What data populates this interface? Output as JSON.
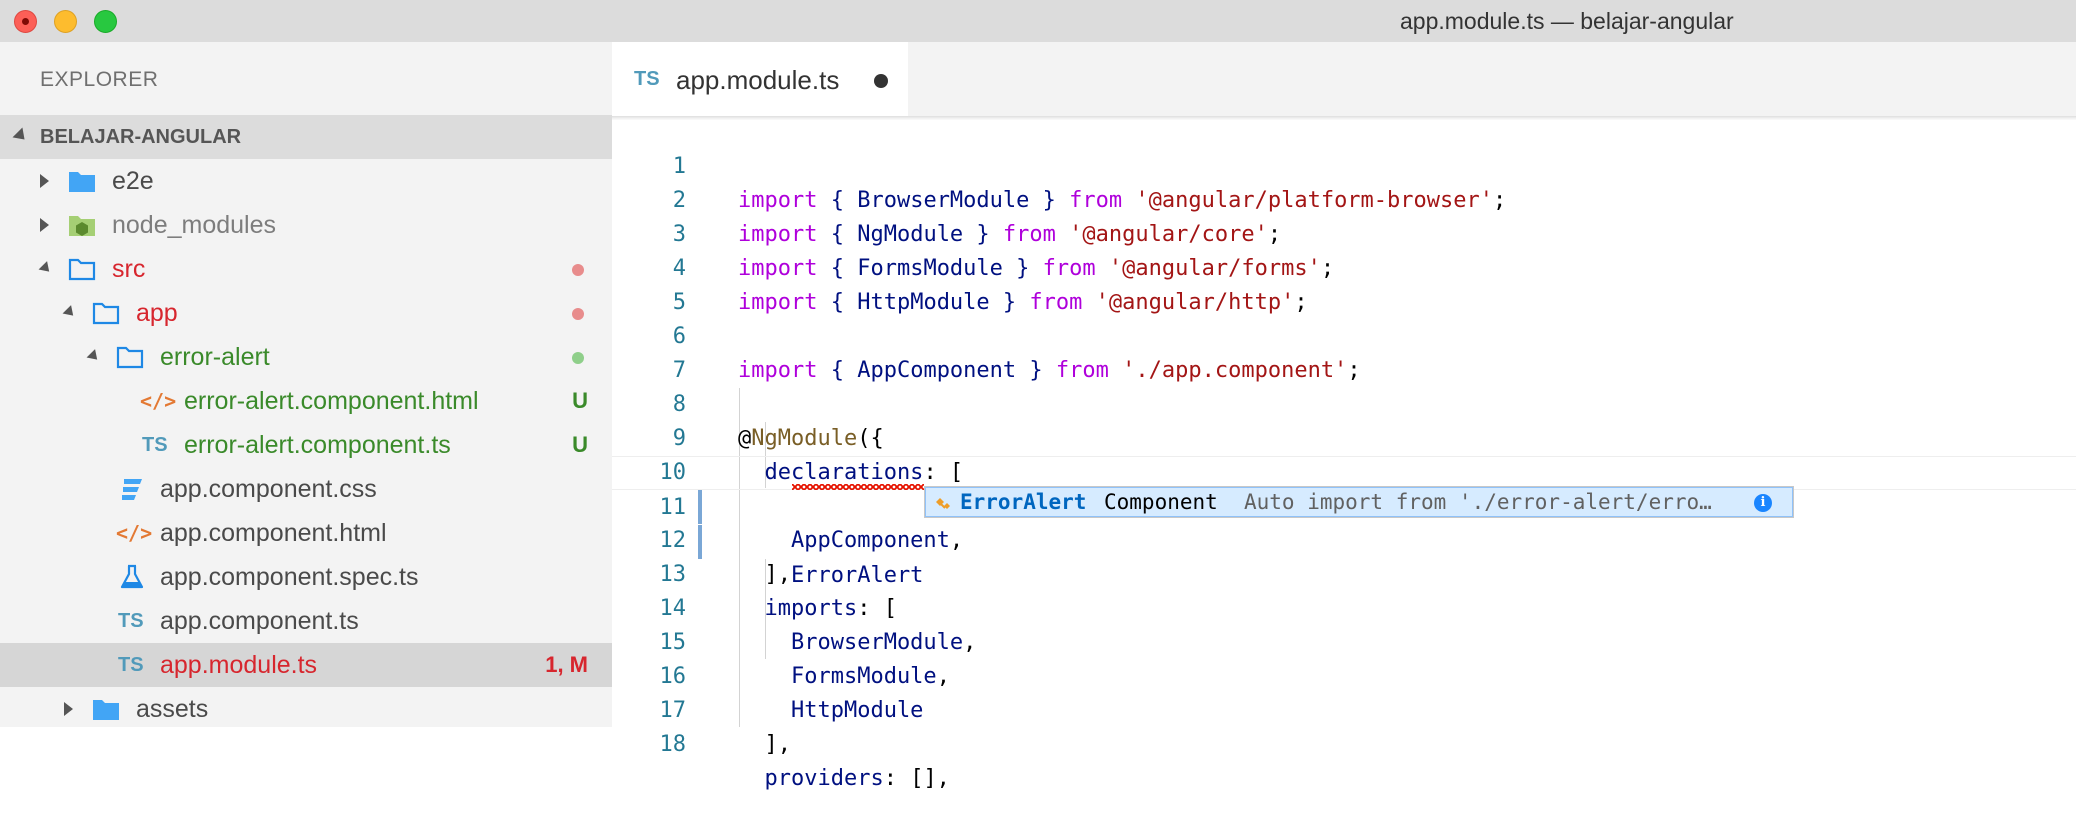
{
  "window": {
    "title": "app.module.ts — belajar-angular"
  },
  "sidebar": {
    "title": "EXPLORER",
    "section": "BELAJAR-ANGULAR",
    "items": [
      {
        "label": "e2e",
        "icon": "folder-icon",
        "status": ""
      },
      {
        "label": "node_modules",
        "icon": "node-folder-icon",
        "status": ""
      },
      {
        "label": "src",
        "icon": "folder-open-icon",
        "status": ""
      },
      {
        "label": "app",
        "icon": "folder-open-icon",
        "status": ""
      },
      {
        "label": "error-alert",
        "icon": "folder-open-icon",
        "status": ""
      },
      {
        "label": "error-alert.component.html",
        "icon": "html-file-icon",
        "status": "U"
      },
      {
        "label": "error-alert.component.ts",
        "icon": "ts-file-icon",
        "status": "U"
      },
      {
        "label": "app.component.css",
        "icon": "css-file-icon",
        "status": ""
      },
      {
        "label": "app.component.html",
        "icon": "html-file-icon",
        "status": ""
      },
      {
        "label": "app.component.spec.ts",
        "icon": "test-file-icon",
        "status": ""
      },
      {
        "label": "app.component.ts",
        "icon": "ts-file-icon",
        "status": ""
      },
      {
        "label": "app.module.ts",
        "icon": "ts-file-icon",
        "status": "1, M"
      },
      {
        "label": "assets",
        "icon": "folder-icon",
        "status": ""
      }
    ],
    "badges": {
      "ts": "TS",
      "html": "</>"
    }
  },
  "tab": {
    "badge": "TS",
    "label": "app.module.ts"
  },
  "code": {
    "line_numbers": [
      "1",
      "2",
      "3",
      "4",
      "5",
      "6",
      "7",
      "8",
      "9",
      "10",
      "11",
      "12",
      "13",
      "14",
      "15",
      "16",
      "17",
      "18"
    ],
    "l1": {
      "kw": "import",
      "a": " { BrowserModule } ",
      "from": "from",
      "s": " '@angular/platform-browser'",
      "e": ";"
    },
    "l2": {
      "kw": "import",
      "a": " { NgModule } ",
      "from": "from",
      "s": " '@angular/core'",
      "e": ";"
    },
    "l3": {
      "kw": "import",
      "a": " { FormsModule } ",
      "from": "from",
      "s": " '@angular/forms'",
      "e": ";"
    },
    "l4": {
      "kw": "import",
      "a": " { HttpModule } ",
      "from": "from",
      "s": " '@angular/http'",
      "e": ";"
    },
    "l6": {
      "kw": "import",
      "a": " { AppComponent } ",
      "from": "from",
      "s": " './app.component'",
      "e": ";"
    },
    "l8": {
      "at": "@",
      "deco": "NgModule",
      "rest": "({"
    },
    "l9": {
      "key": "  declarations",
      "rest": ": ["
    },
    "l10": {
      "id": "    AppComponent",
      "rest": ","
    },
    "l11": {
      "id": "    ErrorAlert"
    },
    "l12": {
      "rest": "  ],"
    },
    "l13": {
      "key": "  imports",
      "rest": ": ["
    },
    "l14": {
      "id": "    BrowserModule",
      "rest": ","
    },
    "l15": {
      "id": "    FormsModule",
      "rest": ","
    },
    "l16": {
      "id": "    HttpModule"
    },
    "l17": {
      "rest": "  ],"
    },
    "l18": {
      "key": "  providers",
      "rest": ": [],"
    }
  },
  "suggestion": {
    "match": "ErrorAlert",
    "rest": "Component",
    "detail": "Auto import from './error-alert/erro…",
    "info": "i"
  },
  "colors": {
    "keyword": "#af00db",
    "string": "#a31515",
    "identifier": "#001080",
    "line_number": "#237893",
    "untracked": "#3a8a2a",
    "modified": "#d7262e"
  }
}
